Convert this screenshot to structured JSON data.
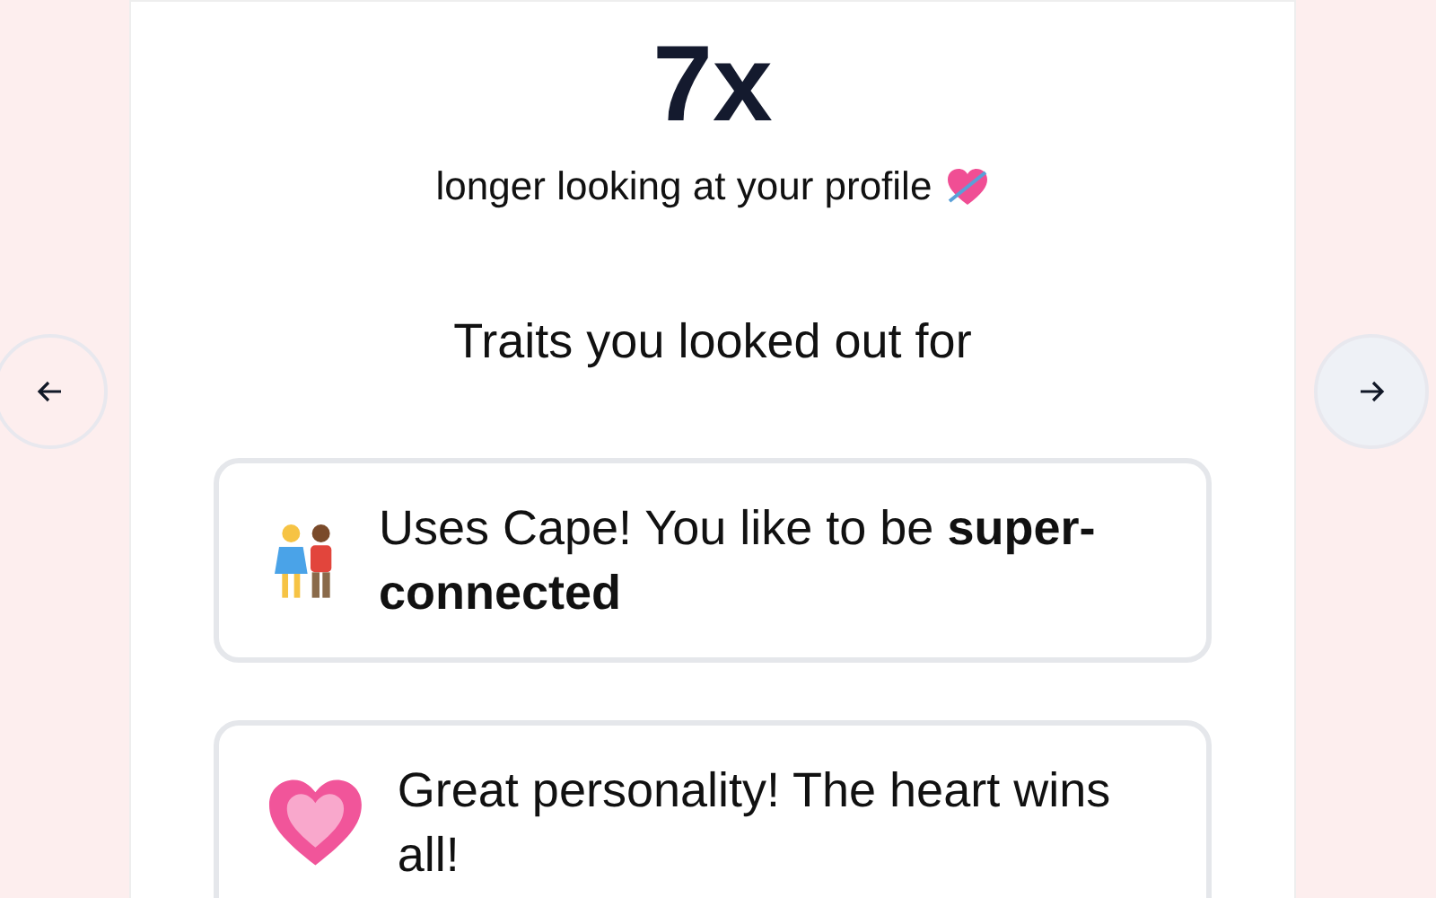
{
  "stat": {
    "value": "7x",
    "caption": "longer looking at your profile"
  },
  "section_title": "Traits you looked out for",
  "traits": [
    {
      "kind": "couple",
      "text": "Uses Cape! You like to be **super-connected**"
    },
    {
      "kind": "heart",
      "text": "Great personality! The heart wins all!"
    }
  ],
  "nav": {
    "prev": {
      "disabled": true
    },
    "next": {
      "disabled": false
    }
  }
}
